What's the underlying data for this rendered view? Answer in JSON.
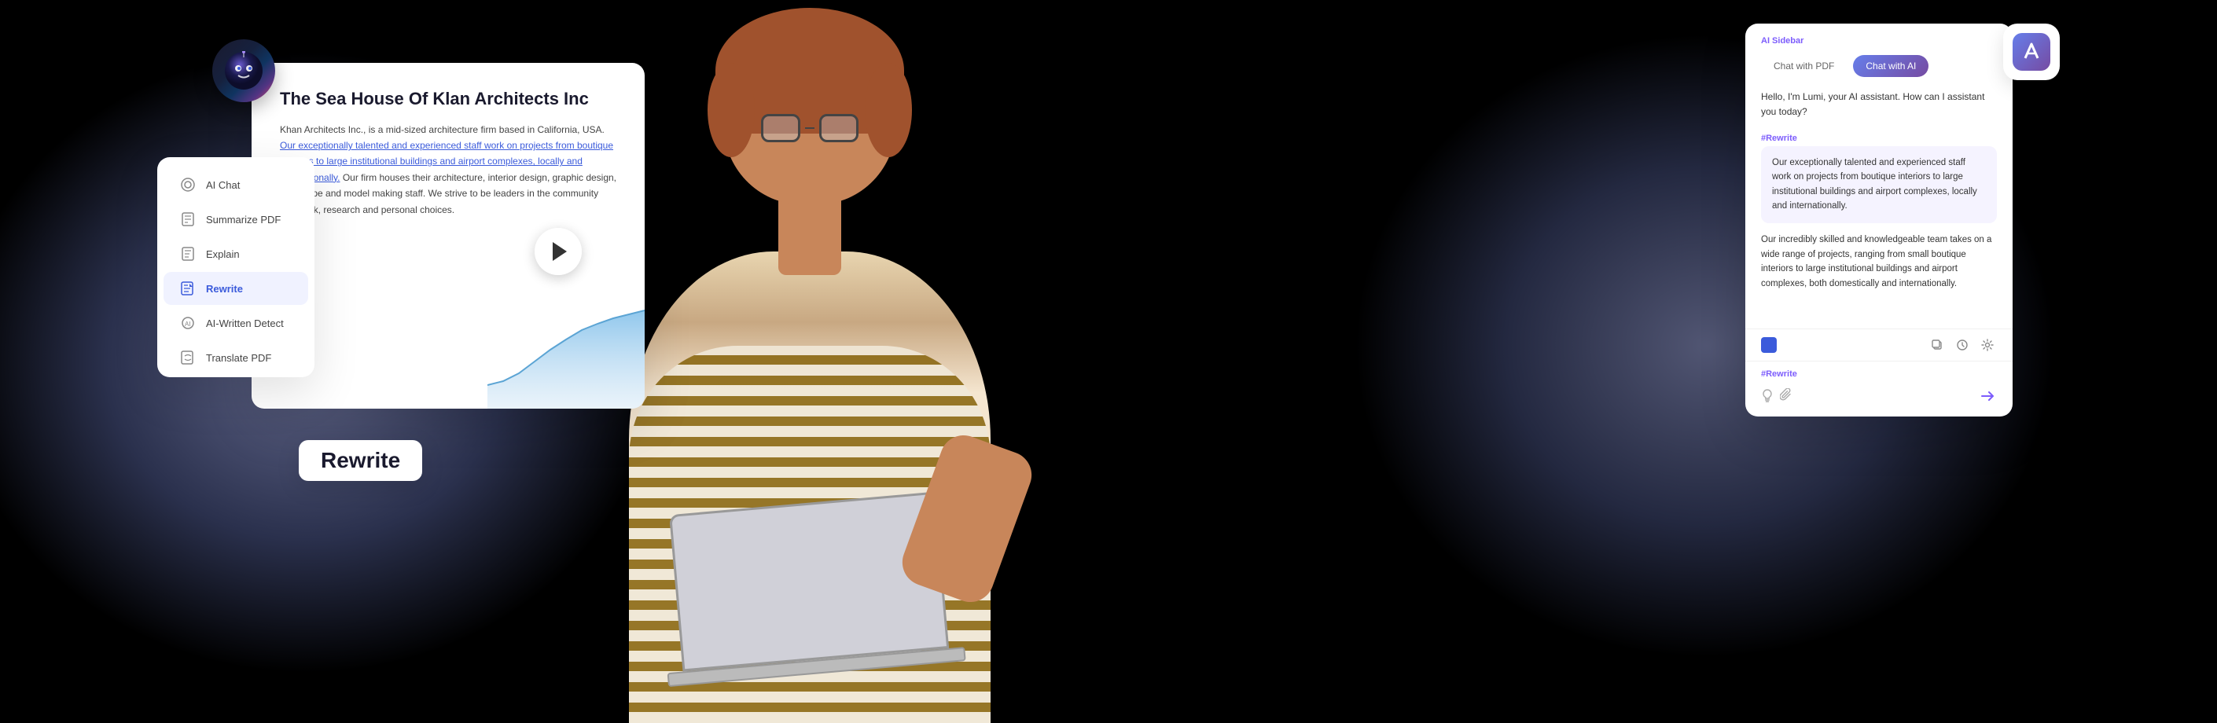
{
  "app": {
    "logo_icon": "✏",
    "robot_icon": "🤖"
  },
  "background": {
    "bg_color": "#000000"
  },
  "doc_panel": {
    "title": "The Sea House Of Klan Architects Inc",
    "body_text_1": "Khan Architects Inc., is a mid-sized architecture firm based in California, USA.",
    "highlight_text": "Our exceptionally talented and experienced staff work on projects from boutique interiors to large institutional buildings and airport complexes, locally and internationally.",
    "body_text_2": "Our firm houses their architecture, interior design, graphic design, landscape and model making staff. We strive to be leaders in the community and work, research and personal choices."
  },
  "sidebar": {
    "items": [
      {
        "id": "ai-chat",
        "label": "AI Chat",
        "icon": "💬"
      },
      {
        "id": "summarize-pdf",
        "label": "Summarize PDF",
        "icon": "📄"
      },
      {
        "id": "explain",
        "label": "Explain",
        "icon": "📝"
      },
      {
        "id": "rewrite",
        "label": "Rewrite",
        "icon": "✏",
        "active": true
      },
      {
        "id": "ai-written-detect",
        "label": "AI-Written Detect",
        "icon": "🤖"
      },
      {
        "id": "translate-pdf",
        "label": "Translate PDF",
        "icon": "🌐"
      }
    ]
  },
  "chat_panel": {
    "sidebar_label": "AI Sidebar",
    "tab_pdf": "Chat with PDF",
    "tab_ai": "Chat with AI",
    "active_tab": "ai",
    "greeting": "Hello, I'm Lumi, your AI assistant. How can I assistant you today?",
    "rewrite_tag_1": "#Rewrite",
    "bubble_text": "Our exceptionally talented and experienced staff work on projects from boutique interiors to large institutional buildings and airport complexes, locally and internationally.",
    "response_text": "Our incredibly skilled and knowledgeable team takes on a wide range of projects, ranging from small boutique interiors to large institutional buildings and airport complexes, both domestically and internationally.",
    "rewrite_tag_2": "#Rewrite",
    "input_icons": [
      "💡",
      "📎"
    ],
    "send_icon": "➤"
  },
  "rewrite_bubble": {
    "label": "Rewrite"
  },
  "video_play": {
    "label": "Play"
  }
}
